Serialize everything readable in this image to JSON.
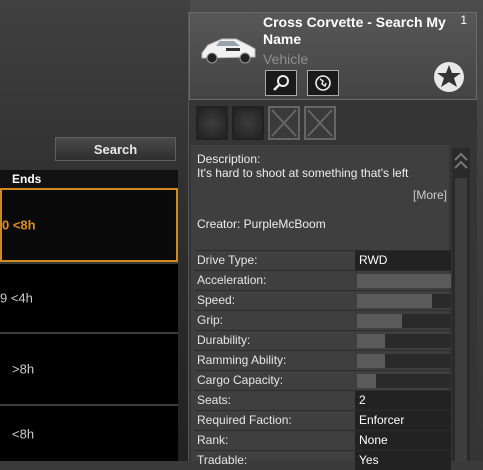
{
  "left": {
    "search_label": "Search",
    "col_ends": "Ends",
    "rows": [
      {
        "time": "0 <8h"
      },
      {
        "time": "9 <4h"
      },
      {
        "time": ">8h"
      },
      {
        "time": "<8h"
      }
    ]
  },
  "vehicle": {
    "name": "Cross Corvette - Search My Name",
    "type": "Vehicle",
    "count": "1",
    "description_label": "Description:",
    "description": "It's hard to shoot at something that's left",
    "more_label": "[More]",
    "creator": "Creator: PurpleMcBoom",
    "stats": [
      {
        "label": "Drive Type:",
        "value": "RWD"
      },
      {
        "label": "Acceleration:",
        "bar": 1.0
      },
      {
        "label": "Speed:",
        "bar": 0.8
      },
      {
        "label": "Grip:",
        "bar": 0.48
      },
      {
        "label": "Durability:",
        "bar": 0.3
      },
      {
        "label": "Ramming Ability:",
        "bar": 0.3
      },
      {
        "label": "Cargo Capacity:",
        "bar": 0.2
      },
      {
        "label": "Seats:",
        "value": "2"
      },
      {
        "label": "Required Faction:",
        "value": "Enforcer"
      },
      {
        "label": "Rank:",
        "value": "None"
      },
      {
        "label": "Tradable:",
        "value": "Yes"
      }
    ]
  },
  "colors": {
    "accent": "#d08a20",
    "selected_text": "#e08a1a"
  }
}
